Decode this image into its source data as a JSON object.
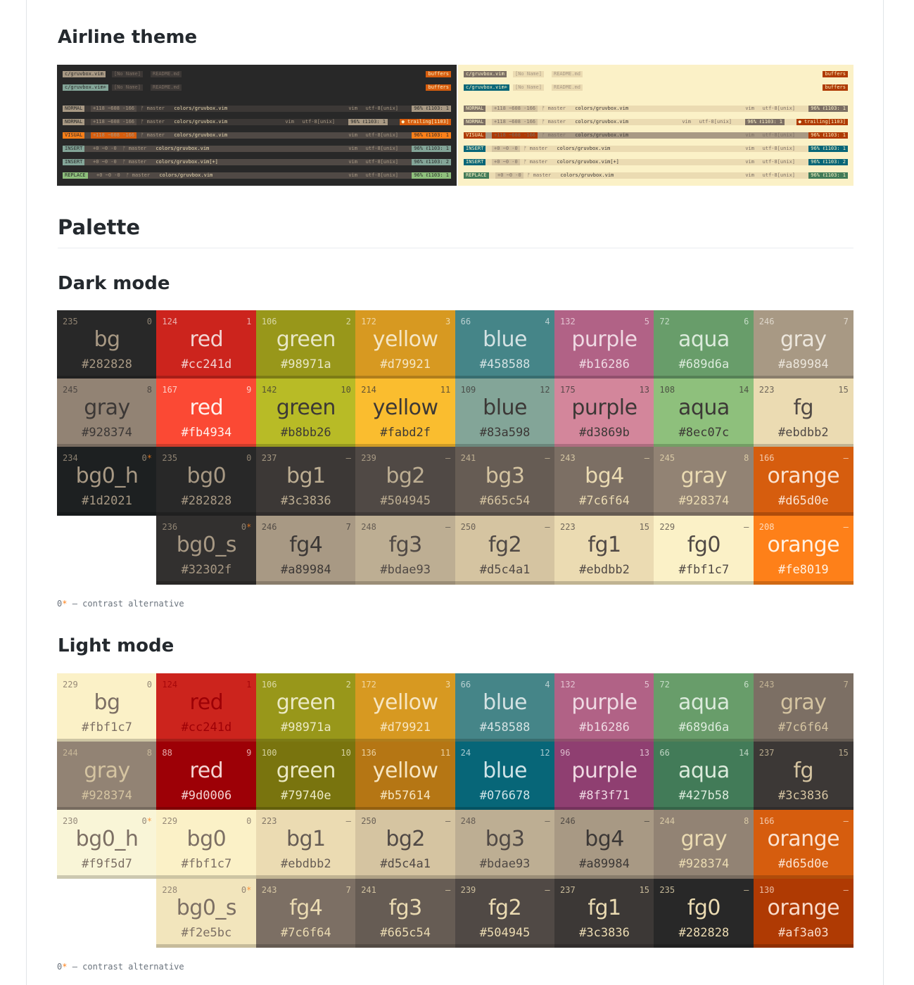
{
  "headings": {
    "airline": "Airline theme",
    "palette": "Palette",
    "dark": "Dark mode",
    "light": "Light mode"
  },
  "note": {
    "prefix": "0",
    "star": "*",
    "text": " — contrast alternative"
  },
  "airline": {
    "tab_rows": [
      {
        "active": "c/gruvbox.vim",
        "tabs": [
          "[No Name]",
          "README.md"
        ],
        "right": "buffers"
      },
      {
        "active": "c/gruvbox.vim+",
        "tabs": [
          "[No Name]",
          "README.md"
        ],
        "right": "buffers"
      }
    ],
    "status_rows": [
      {
        "mode": "NORMAL",
        "hunks": "+118 ~608 -166",
        "branch": "ᚠ master",
        "file": "colors/gruvbox.vim",
        "ft": "vim",
        "enc": "utf-8[unix]",
        "pos": "96% ℓ1103:  1",
        "warn": ""
      },
      {
        "mode": "NORMAL",
        "hunks": "+118 ~608 -166",
        "branch": "ᚠ master",
        "file": "colors/gruvbox.vim",
        "ft": "vim",
        "enc": "utf-8[unix]",
        "pos": "96% ℓ1103:  1",
        "warn": "● trailing[1103]"
      },
      {
        "mode": "VISUAL",
        "hunks": "+118 ~608 -166",
        "branch": "ᚠ master",
        "file": "colors/gruvbox.vim",
        "ft": "vim",
        "enc": "utf-8[unix]",
        "pos": "96% ℓ1103:  1",
        "warn": ""
      },
      {
        "mode": "INSERT",
        "hunks": "+0 ~0 -0",
        "branch": "ᚠ master",
        "file": "colors/gruvbox.vim",
        "ft": "vim",
        "enc": "utf-8[unix]",
        "pos": "96% ℓ1103:  1",
        "warn": ""
      },
      {
        "mode": "INSERT",
        "hunks": "+0 ~0 -0",
        "branch": "ᚠ master",
        "file": "colors/gruvbox.vim[+]",
        "ft": "vim",
        "enc": "utf-8[unix]",
        "pos": "96% ℓ1103:  2",
        "warn": ""
      },
      {
        "mode": "REPLACE",
        "hunks": "+0 ~0 -0",
        "branch": "ᚠ master",
        "file": "colors/gruvbox.vim",
        "ft": "vim",
        "enc": "utf-8[unix]",
        "pos": "96% ℓ1103:  1",
        "warn": ""
      }
    ],
    "dark_colors": {
      "bg": "#282828",
      "mode": [
        "#a89984",
        "#a89984",
        "#fe8019",
        "#83a598",
        "#83a598",
        "#8ec07c"
      ],
      "mid": [
        "#504945",
        "#504945",
        "#d65d0e",
        "#504945",
        "#504945",
        "#504945"
      ],
      "bar": [
        "#3c3836",
        "#3c3836",
        "#504945",
        "#504945",
        "#504945",
        "#504945"
      ],
      "accent": "#d65d0e"
    },
    "light_colors": {
      "bg": "#fbf1c7",
      "mode": [
        "#7c6f64",
        "#7c6f64",
        "#af3a03",
        "#076678",
        "#076678",
        "#427b58"
      ],
      "mid": [
        "#d5c4a1",
        "#d5c4a1",
        "#af3a03",
        "#d5c4a1",
        "#d5c4a1",
        "#d5c4a1"
      ],
      "bar": [
        "#ebdbb2",
        "#ebdbb2",
        "#a89984",
        "#ebdbb2",
        "#ebdbb2",
        "#ebdbb2"
      ],
      "accent": "#af3a03"
    }
  },
  "dark_palette": [
    [
      {
        "num": "235",
        "idx": "0",
        "name": "bg",
        "hex": "#282828",
        "color": "#282828",
        "text": "#a89984"
      },
      {
        "num": "124",
        "idx": "1",
        "name": "red",
        "hex": "#cc241d",
        "color": "#cc241d",
        "text": "#f2d4d2"
      },
      {
        "num": "106",
        "idx": "2",
        "name": "green",
        "hex": "#98971a",
        "color": "#98971a",
        "text": "#e8e7c6"
      },
      {
        "num": "172",
        "idx": "3",
        "name": "yellow",
        "hex": "#d79921",
        "color": "#d79921",
        "text": "#f5e6c4"
      },
      {
        "num": "66",
        "idx": "4",
        "name": "blue",
        "hex": "#458588",
        "color": "#458588",
        "text": "#d4e2e3"
      },
      {
        "num": "132",
        "idx": "5",
        "name": "purple",
        "hex": "#b16286",
        "color": "#b16286",
        "text": "#efd9e3"
      },
      {
        "num": "72",
        "idx": "6",
        "name": "aqua",
        "hex": "#689d6a",
        "color": "#689d6a",
        "text": "#dcebdc"
      },
      {
        "num": "246",
        "idx": "7",
        "name": "gray",
        "hex": "#a89984",
        "color": "#a89984",
        "text": "#ece6dc"
      }
    ],
    [
      {
        "num": "245",
        "idx": "8",
        "name": "gray",
        "hex": "#928374",
        "color": "#928374",
        "text": "#3c3836"
      },
      {
        "num": "167",
        "idx": "9",
        "name": "red",
        "hex": "#fb4934",
        "color": "#fb4934",
        "text": "#fff0ec"
      },
      {
        "num": "142",
        "idx": "10",
        "name": "green",
        "hex": "#b8bb26",
        "color": "#b8bb26",
        "text": "#3c3836"
      },
      {
        "num": "214",
        "idx": "11",
        "name": "yellow",
        "hex": "#fabd2f",
        "color": "#fabd2f",
        "text": "#3c3836"
      },
      {
        "num": "109",
        "idx": "12",
        "name": "blue",
        "hex": "#83a598",
        "color": "#83a598",
        "text": "#3c3836"
      },
      {
        "num": "175",
        "idx": "13",
        "name": "purple",
        "hex": "#d3869b",
        "color": "#d3869b",
        "text": "#3c3836"
      },
      {
        "num": "108",
        "idx": "14",
        "name": "aqua",
        "hex": "#8ec07c",
        "color": "#8ec07c",
        "text": "#3c3836"
      },
      {
        "num": "223",
        "idx": "15",
        "name": "fg",
        "hex": "#ebdbb2",
        "color": "#ebdbb2",
        "text": "#504945"
      }
    ],
    [
      {
        "num": "234",
        "idx": "0",
        "star": "*",
        "name": "bg0_h",
        "hex": "#1d2021",
        "color": "#1d2021",
        "text": "#a89984"
      },
      {
        "num": "235",
        "idx": "0",
        "name": "bg0",
        "hex": "#282828",
        "color": "#282828",
        "text": "#a89984"
      },
      {
        "num": "237",
        "idx": "—",
        "name": "bg1",
        "hex": "#3c3836",
        "color": "#3c3836",
        "text": "#bdae93"
      },
      {
        "num": "239",
        "idx": "—",
        "name": "bg2",
        "hex": "#504945",
        "color": "#504945",
        "text": "#bdae93"
      },
      {
        "num": "241",
        "idx": "—",
        "name": "bg3",
        "hex": "#665c54",
        "color": "#665c54",
        "text": "#d5c4a1"
      },
      {
        "num": "243",
        "idx": "—",
        "name": "bg4",
        "hex": "#7c6f64",
        "color": "#7c6f64",
        "text": "#ebdbb2"
      },
      {
        "num": "245",
        "idx": "8",
        "name": "gray",
        "hex": "#928374",
        "color": "#928374",
        "text": "#ebdbb2"
      },
      {
        "num": "166",
        "idx": "—",
        "name": "orange",
        "hex": "#d65d0e",
        "color": "#d65d0e",
        "text": "#fbe3d2"
      }
    ],
    [
      null,
      {
        "num": "236",
        "idx": "0",
        "star": "*",
        "name": "bg0_s",
        "hex": "#32302f",
        "color": "#32302f",
        "text": "#a89984"
      },
      {
        "num": "246",
        "idx": "7",
        "name": "fg4",
        "hex": "#a89984",
        "color": "#a89984",
        "text": "#3c3836"
      },
      {
        "num": "248",
        "idx": "—",
        "name": "fg3",
        "hex": "#bdae93",
        "color": "#bdae93",
        "text": "#504945"
      },
      {
        "num": "250",
        "idx": "—",
        "name": "fg2",
        "hex": "#d5c4a1",
        "color": "#d5c4a1",
        "text": "#504945"
      },
      {
        "num": "223",
        "idx": "15",
        "name": "fg1",
        "hex": "#ebdbb2",
        "color": "#ebdbb2",
        "text": "#504945"
      },
      {
        "num": "229",
        "idx": "—",
        "name": "fg0",
        "hex": "#fbf1c7",
        "color": "#fbf1c7",
        "text": "#504945"
      },
      {
        "num": "208",
        "idx": "—",
        "name": "orange",
        "hex": "#fe8019",
        "color": "#fe8019",
        "text": "#fff1e3"
      }
    ]
  ],
  "light_palette": [
    [
      {
        "num": "229",
        "idx": "0",
        "name": "bg",
        "hex": "#fbf1c7",
        "color": "#fbf1c7",
        "text": "#7c6f64"
      },
      {
        "num": "124",
        "idx": "1",
        "name": "red",
        "hex": "#cc241d",
        "color": "#cc241d",
        "text": "#9d0006"
      },
      {
        "num": "106",
        "idx": "2",
        "name": "green",
        "hex": "#98971a",
        "color": "#98971a",
        "text": "#ebe9c4"
      },
      {
        "num": "172",
        "idx": "3",
        "name": "yellow",
        "hex": "#d79921",
        "color": "#d79921",
        "text": "#f7e6c2"
      },
      {
        "num": "66",
        "idx": "4",
        "name": "blue",
        "hex": "#458588",
        "color": "#458588",
        "text": "#d4e2e3"
      },
      {
        "num": "132",
        "idx": "5",
        "name": "purple",
        "hex": "#b16286",
        "color": "#b16286",
        "text": "#efd9e3"
      },
      {
        "num": "72",
        "idx": "6",
        "name": "aqua",
        "hex": "#689d6a",
        "color": "#689d6a",
        "text": "#dcebdc"
      },
      {
        "num": "243",
        "idx": "7",
        "name": "gray",
        "hex": "#7c6f64",
        "color": "#7c6f64",
        "text": "#d5c4a1"
      }
    ],
    [
      {
        "num": "244",
        "idx": "8",
        "name": "gray",
        "hex": "#928374",
        "color": "#928374",
        "text": "#d5c4a1"
      },
      {
        "num": "88",
        "idx": "9",
        "name": "red",
        "hex": "#9d0006",
        "color": "#9d0006",
        "text": "#f4d4d3"
      },
      {
        "num": "100",
        "idx": "10",
        "name": "green",
        "hex": "#79740e",
        "color": "#79740e",
        "text": "#ebe9c4"
      },
      {
        "num": "136",
        "idx": "11",
        "name": "yellow",
        "hex": "#b57614",
        "color": "#b57614",
        "text": "#f7e6c2"
      },
      {
        "num": "24",
        "idx": "12",
        "name": "blue",
        "hex": "#076678",
        "color": "#076678",
        "text": "#cfe3e7"
      },
      {
        "num": "96",
        "idx": "13",
        "name": "purple",
        "hex": "#8f3f71",
        "color": "#8f3f71",
        "text": "#efd9e3"
      },
      {
        "num": "66",
        "idx": "14",
        "name": "aqua",
        "hex": "#427b58",
        "color": "#427b58",
        "text": "#dcebdc"
      },
      {
        "num": "237",
        "idx": "15",
        "name": "fg",
        "hex": "#3c3836",
        "color": "#3c3836",
        "text": "#d5c4a1"
      }
    ],
    [
      {
        "num": "230",
        "idx": "0",
        "star": "*",
        "name": "bg0_h",
        "hex": "#f9f5d7",
        "color": "#f9f5d7",
        "text": "#7c6f64"
      },
      {
        "num": "229",
        "idx": "0",
        "name": "bg0",
        "hex": "#fbf1c7",
        "color": "#fbf1c7",
        "text": "#7c6f64"
      },
      {
        "num": "223",
        "idx": "—",
        "name": "bg1",
        "hex": "#ebdbb2",
        "color": "#ebdbb2",
        "text": "#665c54"
      },
      {
        "num": "250",
        "idx": "—",
        "name": "bg2",
        "hex": "#d5c4a1",
        "color": "#d5c4a1",
        "text": "#504945"
      },
      {
        "num": "248",
        "idx": "—",
        "name": "bg3",
        "hex": "#bdae93",
        "color": "#bdae93",
        "text": "#504945"
      },
      {
        "num": "246",
        "idx": "—",
        "name": "bg4",
        "hex": "#a89984",
        "color": "#a89984",
        "text": "#3c3836"
      },
      {
        "num": "244",
        "idx": "8",
        "name": "gray",
        "hex": "#928374",
        "color": "#928374",
        "text": "#ebdbb2"
      },
      {
        "num": "166",
        "idx": "—",
        "name": "orange",
        "hex": "#d65d0e",
        "color": "#d65d0e",
        "text": "#fbe3d2"
      }
    ],
    [
      null,
      {
        "num": "228",
        "idx": "0",
        "star": "*",
        "name": "bg0_s",
        "hex": "#f2e5bc",
        "color": "#f2e5bc",
        "text": "#7c6f64"
      },
      {
        "num": "243",
        "idx": "7",
        "name": "fg4",
        "hex": "#7c6f64",
        "color": "#7c6f64",
        "text": "#ebdbb2"
      },
      {
        "num": "241",
        "idx": "—",
        "name": "fg3",
        "hex": "#665c54",
        "color": "#665c54",
        "text": "#ebdbb2"
      },
      {
        "num": "239",
        "idx": "—",
        "name": "fg2",
        "hex": "#504945",
        "color": "#504945",
        "text": "#ebdbb2"
      },
      {
        "num": "237",
        "idx": "15",
        "name": "fg1",
        "hex": "#3c3836",
        "color": "#3c3836",
        "text": "#ebdbb2"
      },
      {
        "num": "235",
        "idx": "—",
        "name": "fg0",
        "hex": "#282828",
        "color": "#282828",
        "text": "#ebdbb2"
      },
      {
        "num": "130",
        "idx": "—",
        "name": "orange",
        "hex": "#af3a03",
        "color": "#af3a03",
        "text": "#f9dccb"
      }
    ]
  ]
}
